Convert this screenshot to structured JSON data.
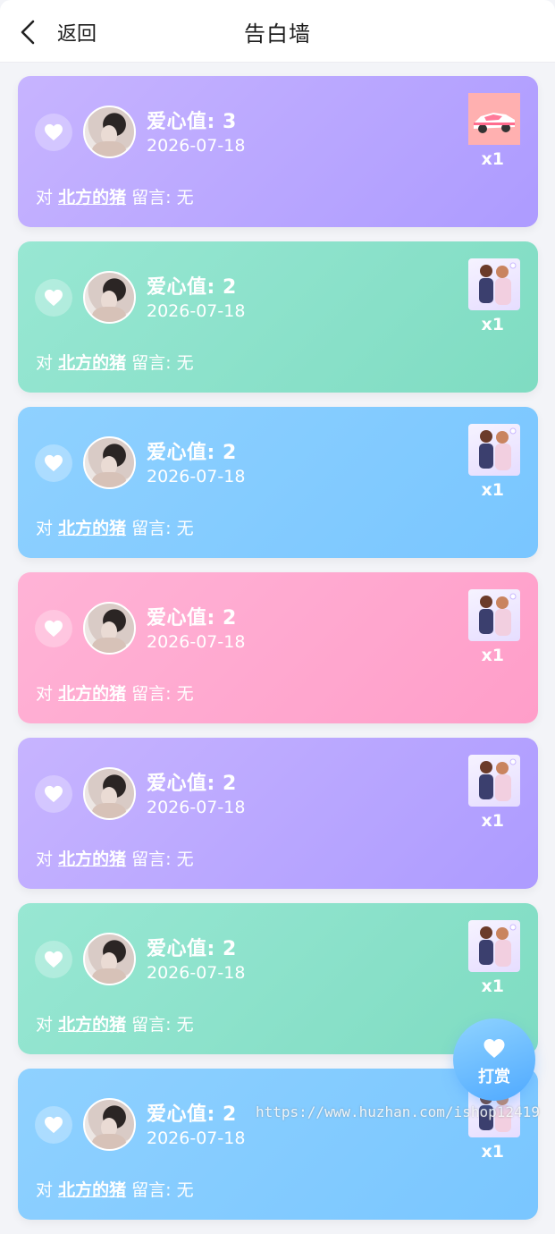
{
  "header": {
    "back_label": "返回",
    "title": "告白墙"
  },
  "cards": [
    {
      "love_label": "爱心值: 3",
      "date": "2026-07-18",
      "prefix": "对",
      "target": "北方的猪",
      "suffix": "留言: 无",
      "gift_count": "x1",
      "gift_icon": "sports-car",
      "theme": "purple"
    },
    {
      "love_label": "爱心值: 2",
      "date": "2026-07-18",
      "prefix": "对",
      "target": "北方的猪",
      "suffix": "留言: 无",
      "gift_count": "x1",
      "gift_icon": "couple",
      "theme": "green"
    },
    {
      "love_label": "爱心值: 2",
      "date": "2026-07-18",
      "prefix": "对",
      "target": "北方的猪",
      "suffix": "留言: 无",
      "gift_count": "x1",
      "gift_icon": "couple",
      "theme": "blue"
    },
    {
      "love_label": "爱心值: 2",
      "date": "2026-07-18",
      "prefix": "对",
      "target": "北方的猪",
      "suffix": "留言: 无",
      "gift_count": "x1",
      "gift_icon": "couple",
      "theme": "pink"
    },
    {
      "love_label": "爱心值: 2",
      "date": "2026-07-18",
      "prefix": "对",
      "target": "北方的猪",
      "suffix": "留言: 无",
      "gift_count": "x1",
      "gift_icon": "couple",
      "theme": "purple"
    },
    {
      "love_label": "爱心值: 2",
      "date": "2026-07-18",
      "prefix": "对",
      "target": "北方的猪",
      "suffix": "留言: 无",
      "gift_count": "x1",
      "gift_icon": "couple",
      "theme": "green"
    },
    {
      "love_label": "爱心值: 2",
      "date": "2026-07-18",
      "prefix": "对",
      "target": "北方的猪",
      "suffix": "留言: 无",
      "gift_count": "x1",
      "gift_icon": "couple",
      "theme": "blue"
    }
  ],
  "reward_button": {
    "label": "打赏"
  },
  "watermark": "https://www.huzhan.com/ishop12419",
  "colors": {
    "purple": "#b9a6ff",
    "green": "#8ce3cc",
    "blue": "#84cbff",
    "pink": "#ffa8d0",
    "reward": "#5fb3ff"
  }
}
